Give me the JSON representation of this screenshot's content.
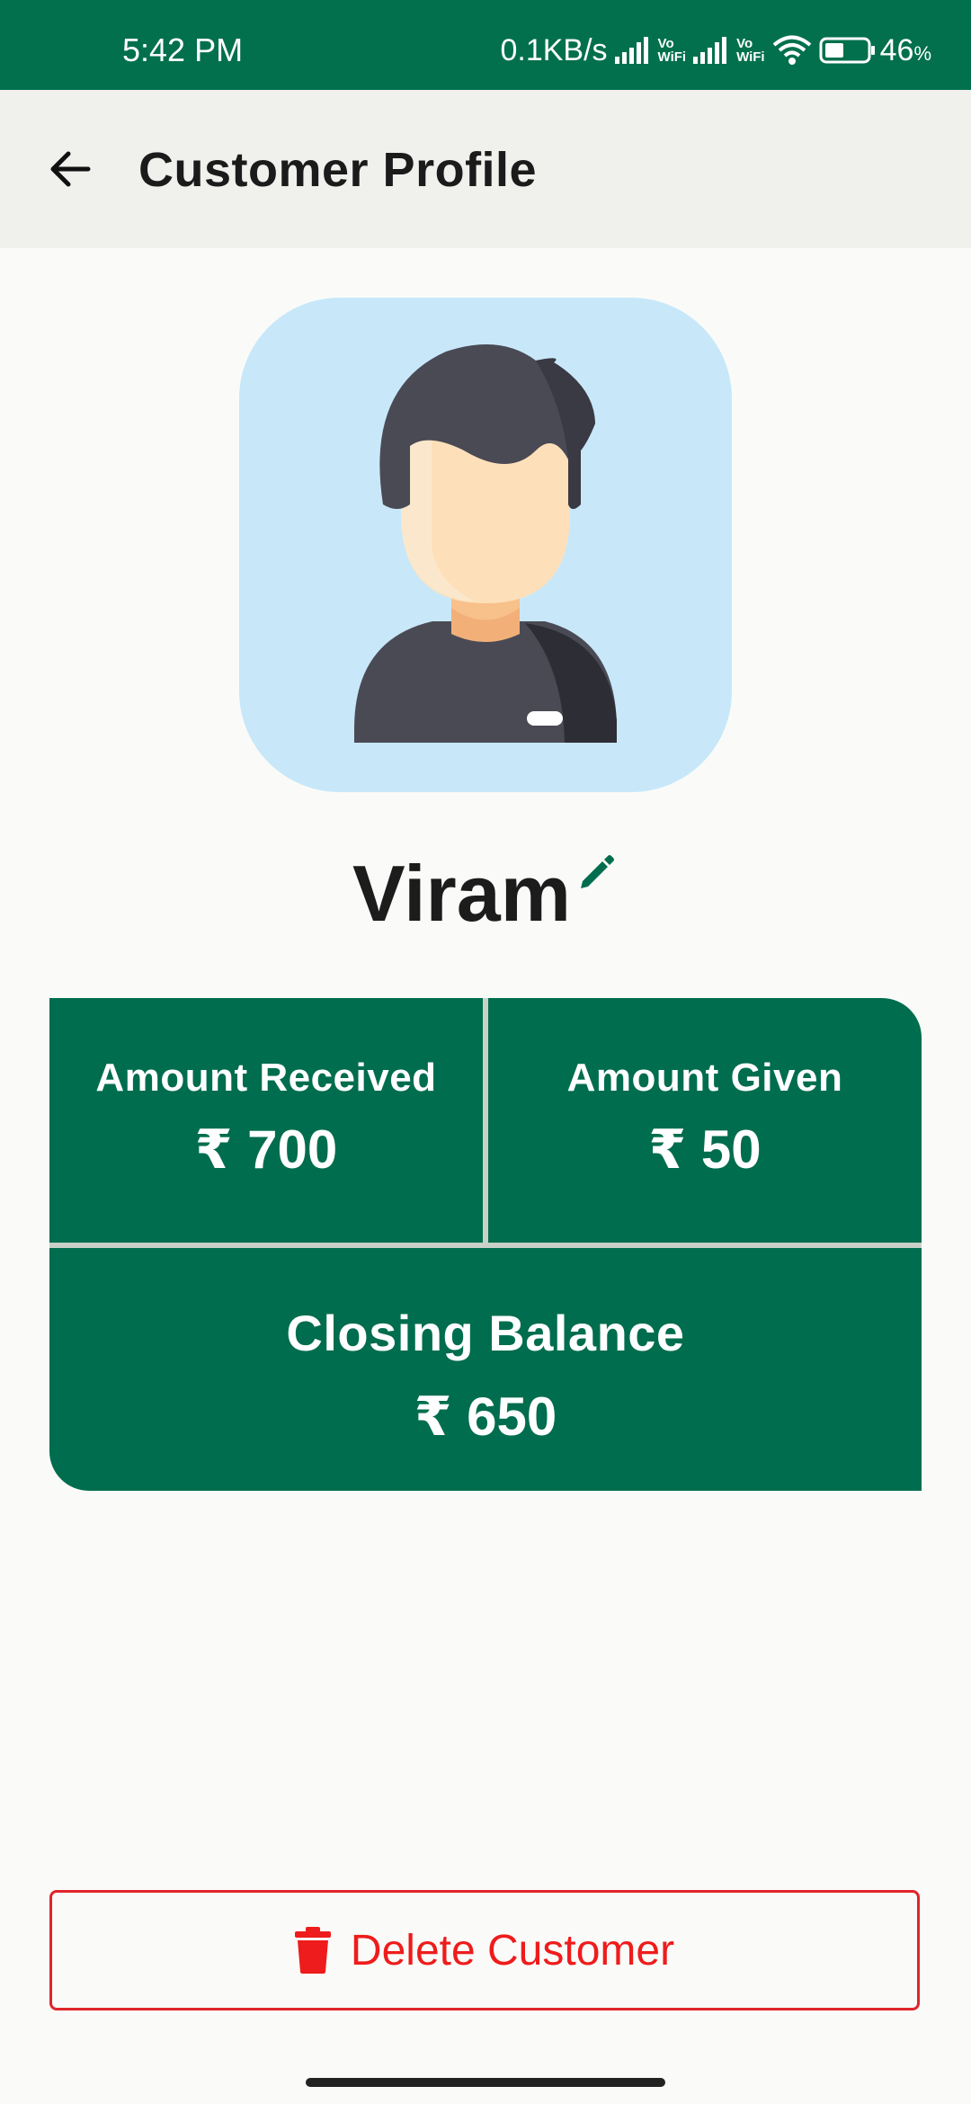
{
  "status_bar": {
    "time": "5:42 PM",
    "network_speed": "0.1KB/s",
    "vowifi_top": "Vo",
    "vowifi_bottom": "WiFi",
    "battery_percent": "46",
    "battery_suffix": "%",
    "battery_level": 0.46
  },
  "app_bar": {
    "title": "Customer Profile",
    "back_icon": "arrow-left-icon"
  },
  "profile": {
    "avatar_icon": "user-avatar-icon",
    "name": "Viram",
    "edit_icon": "pencil-icon"
  },
  "summary": {
    "received_label": "Amount Received",
    "received_value": "₹ 700",
    "given_label": "Amount Given",
    "given_value": "₹ 50",
    "balance_label": "Closing Balance",
    "balance_value": "₹ 650"
  },
  "actions": {
    "delete_label": "Delete Customer",
    "delete_icon": "trash-icon"
  },
  "colors": {
    "primary_green": "#006d4e",
    "status_green": "#02704c",
    "danger_red": "#ee1c1c",
    "avatar_bg": "#c8e8fa"
  }
}
